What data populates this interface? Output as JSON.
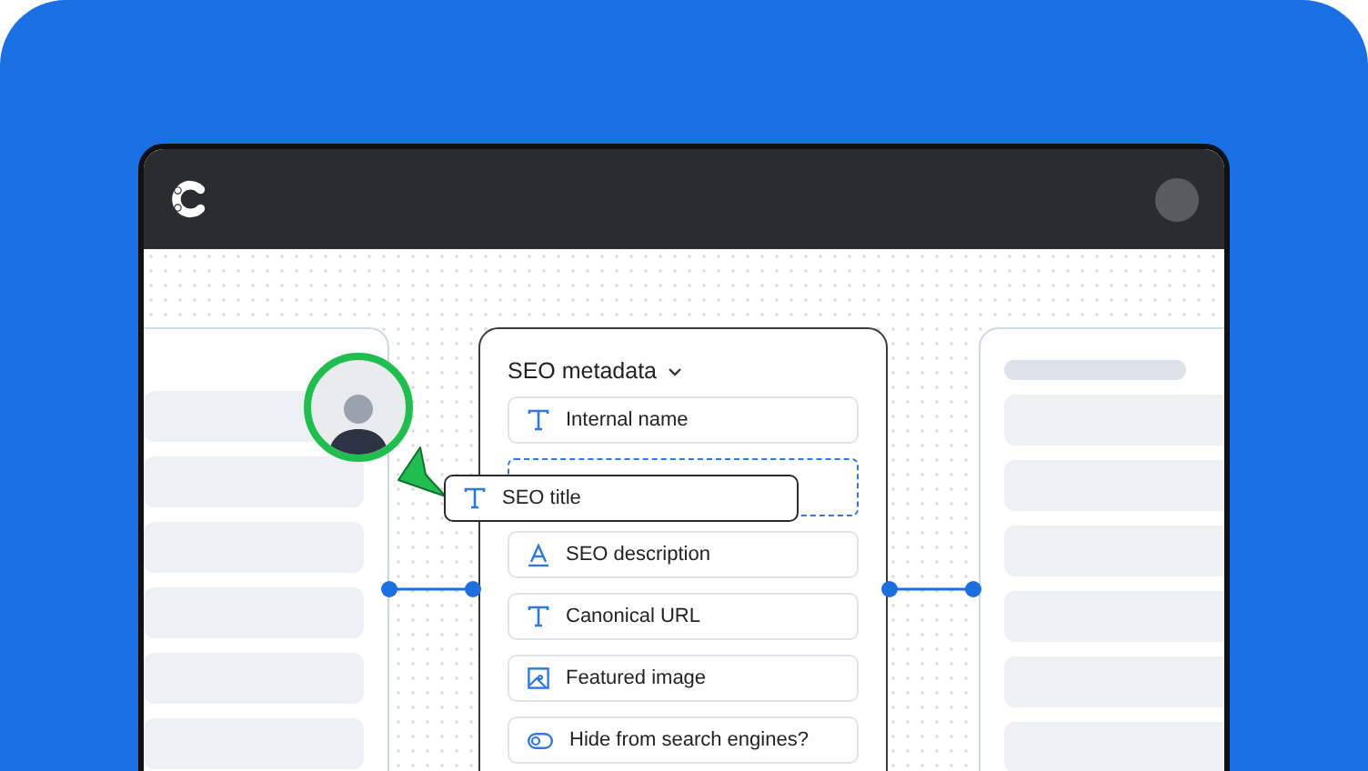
{
  "panel": {
    "title": "SEO metadata",
    "fields": [
      {
        "label": "Internal name",
        "kind": "text"
      },
      {
        "kind": "drop_slot"
      },
      {
        "label": "SEO description",
        "kind": "rich_text"
      },
      {
        "label": "Canonical URL",
        "kind": "text"
      },
      {
        "label": "Featured image",
        "kind": "media"
      },
      {
        "label": "Hide from search engines?",
        "kind": "boolean"
      }
    ]
  },
  "dragged_field": {
    "label": "SEO title",
    "kind": "text"
  }
}
